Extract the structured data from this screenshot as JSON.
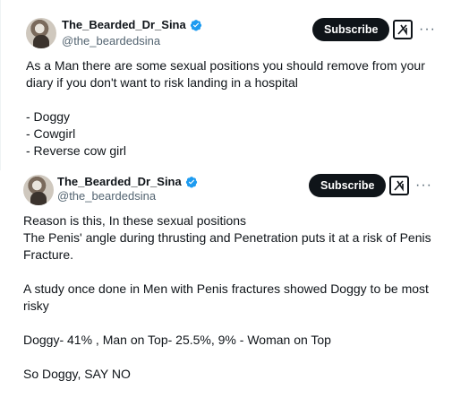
{
  "post1": {
    "author_name": "The_Bearded_Dr_Sina",
    "author_handle": "@the_beardedsina",
    "subscribe_label": "Subscribe",
    "more_label": "···",
    "text": "As a Man there are some sexual positions you should remove from your diary if you don't want to risk landing in a hospital\n\n- Doggy\n- Cowgirl\n- Reverse cow girl"
  },
  "post2": {
    "author_name": "The_Bearded_Dr_Sina",
    "author_handle": "@the_beardedsina",
    "subscribe_label": "Subscribe",
    "more_label": "···",
    "text": "Reason is this, In these sexual positions\nThe Penis' angle during thrusting and Penetration puts it at a risk of Penis Fracture.\n\nA study once done in Men with Penis fractures showed Doggy to be most risky\n\nDoggy- 41% , Man on Top- 25.5%, 9% - Woman on Top\n\nSo Doggy, SAY NO"
  },
  "colors": {
    "text": "#0f1419",
    "secondary": "#536471",
    "verified_blue": "#1d9bf0",
    "button_bg": "#0f1419"
  },
  "icons": {
    "verified": "verified-badge-icon",
    "grok": "grok-icon",
    "more": "more-options-icon"
  }
}
